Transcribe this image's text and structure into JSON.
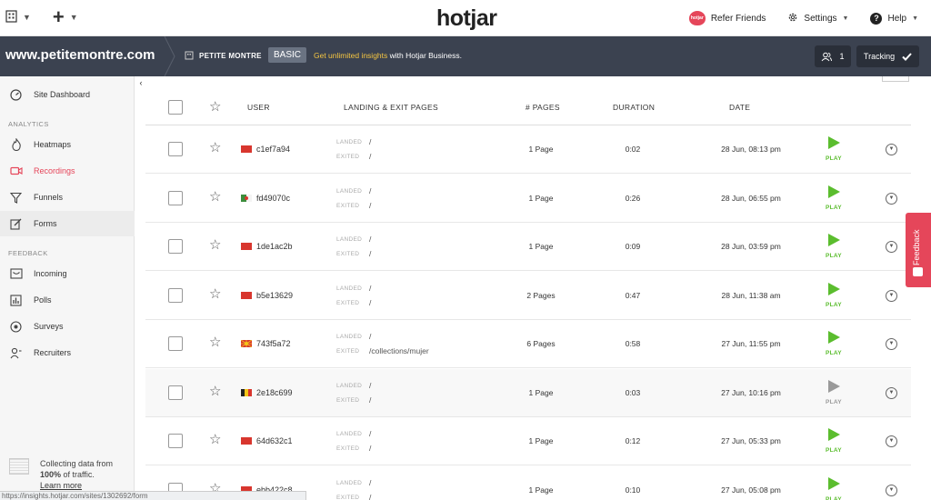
{
  "topbar": {
    "logo": "hotjar",
    "refer": "Refer Friends",
    "heart_text": "hotjar",
    "settings": "Settings",
    "help": "Help",
    "plus": "+"
  },
  "sitebar": {
    "domain": "www.petitemontre.com",
    "site_name": "PETITE MONTRE",
    "plan": "BASIC",
    "upsell_link": "Get unlimited insights",
    "upsell_rest": " with Hotjar Business.",
    "users_count": "1",
    "tracking": "Tracking"
  },
  "sidebar": {
    "dashboard": "Site Dashboard",
    "analytics_title": "ANALYTICS",
    "analytics": [
      "Heatmaps",
      "Recordings",
      "Funnels",
      "Forms"
    ],
    "feedback_title": "FEEDBACK",
    "feedback": [
      "Incoming",
      "Polls",
      "Surveys",
      "Recruiters"
    ],
    "collect_line1": "Collecting data from",
    "collect_pct": "100%",
    "collect_line2": " of traffic.",
    "learn_more": "Learn more"
  },
  "status_url": "https://insights.hotjar.com/sites/1302692/form",
  "feedback_tab": "Feedback",
  "table": {
    "headers": {
      "user": "USER",
      "pages_landing": "LANDING & EXIT PAGES",
      "num_pages": "# PAGES",
      "duration": "DURATION",
      "date": "DATE"
    },
    "landed_label": "LANDED",
    "exited_label": "EXITED",
    "play_label": "PLAY",
    "rows": [
      {
        "flag": "red",
        "user": "c1ef7a94",
        "landed": "/",
        "exited": "/",
        "pages": "1 Page",
        "duration": "0:02",
        "date": "28 Jun, 08:13 pm",
        "watched": false
      },
      {
        "flag": "algeria",
        "user": "fd49070c",
        "landed": "/",
        "exited": "/",
        "pages": "1 Page",
        "duration": "0:26",
        "date": "28 Jun, 06:55 pm",
        "watched": false
      },
      {
        "flag": "red",
        "user": "1de1ac2b",
        "landed": "/",
        "exited": "/",
        "pages": "1 Page",
        "duration": "0:09",
        "date": "28 Jun, 03:59 pm",
        "watched": false
      },
      {
        "flag": "red",
        "user": "b5e13629",
        "landed": "/",
        "exited": "/",
        "pages": "2 Pages",
        "duration": "0:47",
        "date": "28 Jun, 11:38 am",
        "watched": false
      },
      {
        "flag": "macedonia",
        "user": "743f5a72",
        "landed": "/",
        "exited": "/collections/mujer",
        "pages": "6 Pages",
        "duration": "0:58",
        "date": "27 Jun, 11:55 pm",
        "watched": false
      },
      {
        "flag": "belgium",
        "user": "2e18c699",
        "landed": "/",
        "exited": "/",
        "pages": "1 Page",
        "duration": "0:03",
        "date": "27 Jun, 10:16 pm",
        "watched": true
      },
      {
        "flag": "red",
        "user": "64d632c1",
        "landed": "/",
        "exited": "/",
        "pages": "1 Page",
        "duration": "0:12",
        "date": "27 Jun, 05:33 pm",
        "watched": false
      },
      {
        "flag": "red",
        "user": "ebb422c8",
        "landed": "/",
        "exited": "/",
        "pages": "1 Page",
        "duration": "0:10",
        "date": "27 Jun, 05:08 pm",
        "watched": false
      }
    ]
  },
  "colors": {
    "accent": "#e5465a",
    "play_green": "#5bbd2e",
    "play_grey": "#9a9a9a",
    "header_dark": "#3b4250"
  }
}
